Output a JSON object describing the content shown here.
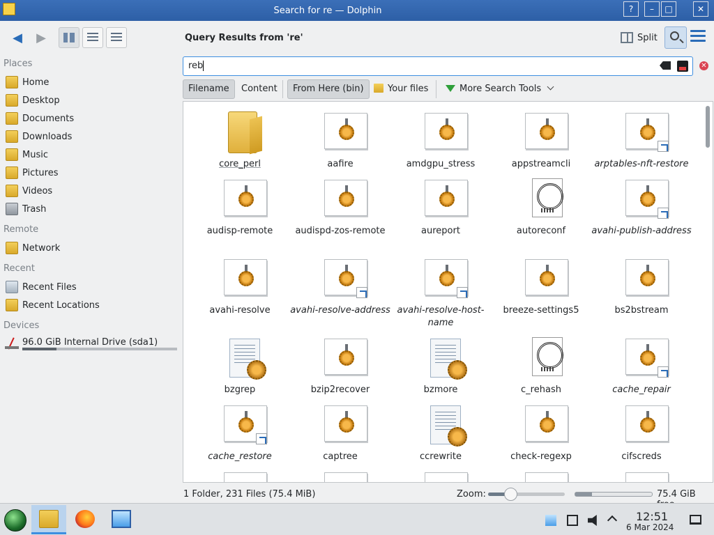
{
  "window": {
    "title": "Search for re — Dolphin"
  },
  "header": {
    "query_title": "Query Results from 're'",
    "split_label": "Split"
  },
  "search": {
    "value": "reb",
    "placeholder": ""
  },
  "filters": {
    "filename": "Filename",
    "content": "Content",
    "from_here": "From Here (bin)",
    "your_files": "Your files",
    "more_tools": "More Search Tools"
  },
  "sidebar": {
    "places_title": "Places",
    "places": [
      "Home",
      "Desktop",
      "Documents",
      "Downloads",
      "Music",
      "Pictures",
      "Videos",
      "Trash"
    ],
    "remote_title": "Remote",
    "remote": [
      "Network"
    ],
    "recent_title": "Recent",
    "recent": [
      "Recent Files",
      "Recent Locations"
    ],
    "devices_title": "Devices",
    "devices": [
      "96.0 GiB Internal Drive (sda1)"
    ],
    "drive_usage_fraction": 0.22
  },
  "files": [
    {
      "name": "core_perl",
      "type": "folder"
    },
    {
      "name": "aafire",
      "type": "exe"
    },
    {
      "name": "amdgpu_stress",
      "type": "exe"
    },
    {
      "name": "appstreamcli",
      "type": "exe"
    },
    {
      "name": "arptables-nft-restore",
      "type": "exe-link"
    },
    {
      "name": "audisp-remote",
      "type": "exe"
    },
    {
      "name": "audispd-zos-remote",
      "type": "exe"
    },
    {
      "name": "aureport",
      "type": "exe"
    },
    {
      "name": "autoreconf",
      "type": "cert"
    },
    {
      "name": "avahi-publish-address",
      "type": "exe-link"
    },
    {
      "name": "avahi-resolve",
      "type": "exe"
    },
    {
      "name": "avahi-resolve-address",
      "type": "exe-link"
    },
    {
      "name": "avahi-resolve-host-name",
      "type": "exe-link"
    },
    {
      "name": "breeze-settings5",
      "type": "exe"
    },
    {
      "name": "bs2bstream",
      "type": "exe"
    },
    {
      "name": "bzgrep",
      "type": "script"
    },
    {
      "name": "bzip2recover",
      "type": "exe"
    },
    {
      "name": "bzmore",
      "type": "script"
    },
    {
      "name": "c_rehash",
      "type": "cert"
    },
    {
      "name": "cache_repair",
      "type": "exe-link"
    },
    {
      "name": "cache_restore",
      "type": "exe-link"
    },
    {
      "name": "captree",
      "type": "exe"
    },
    {
      "name": "ccrewrite",
      "type": "script"
    },
    {
      "name": "check-regexp",
      "type": "exe"
    },
    {
      "name": "cifscreds",
      "type": "exe"
    }
  ],
  "status": {
    "summary": "1 Folder, 231 Files (75.4 MiB)",
    "zoom_label": "Zoom:",
    "zoom_fraction": 0.3,
    "space_used_fraction": 0.22,
    "free_space": "75.4 GiB free"
  },
  "taskbar": {
    "time": "12:51",
    "date": "6 Mar 2024"
  }
}
